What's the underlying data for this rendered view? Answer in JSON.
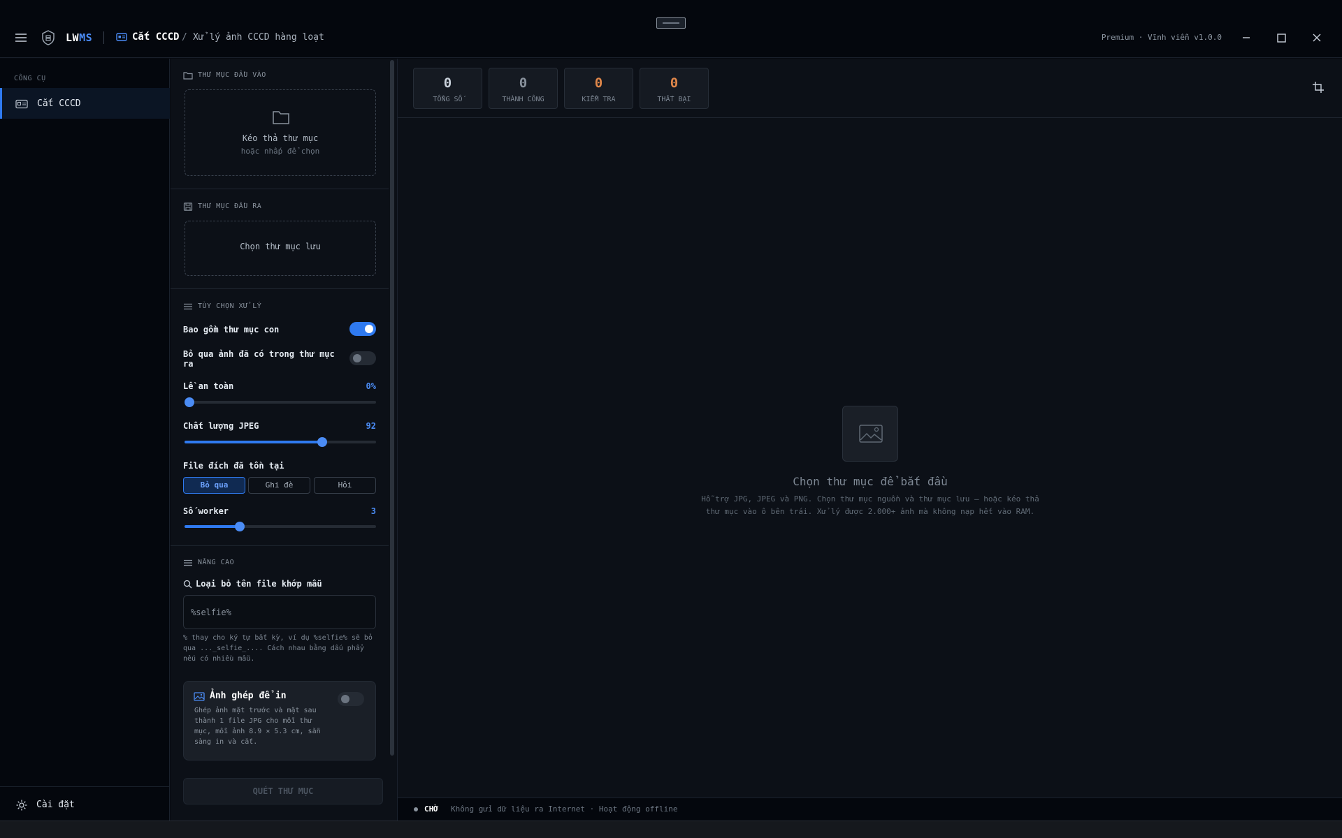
{
  "titlebar": {
    "brand_prefix": "LW",
    "brand_accent": "MS",
    "breadcrumb_main": "Cắt CCCD",
    "breadcrumb_sep": "/",
    "breadcrumb_sub": "Xử lý ảnh CCCD hàng loạt",
    "plan": "Premium · Vĩnh viễn  v1.0.0"
  },
  "nav": {
    "section": "CÔNG CỤ",
    "items": [
      {
        "label": "Cắt CCCD",
        "icon": "id-card-icon",
        "active": true
      }
    ],
    "settings_label": "Cài đặt"
  },
  "panel": {
    "input": {
      "header": "THƯ MỤC ĐẦU VÀO",
      "dropzone_title": "Kéo thả thư mục",
      "dropzone_sub": "hoặc nhấp để chọn"
    },
    "output": {
      "header": "THƯ MỤC ĐẦU RA",
      "dropzone_label": "Chọn thư mục lưu"
    },
    "options": {
      "header": "TÙY CHỌN XỬ LÝ",
      "include_subfolders": {
        "label": "Bao gồm thư mục con",
        "on": true
      },
      "skip_existing": {
        "label": "Bỏ qua ảnh đã có trong thư mục ra",
        "on": false
      },
      "safety_margin": {
        "label": "Lề an toàn",
        "value_text": "0%",
        "fraction": 0.0
      },
      "jpeg_quality": {
        "label": "Chất lượng JPEG",
        "value_text": "92",
        "fraction": 0.72
      },
      "existing_file": {
        "label": "File đích đã tồn tại",
        "choices": [
          "Bỏ qua",
          "Ghi đè",
          "Hỏi"
        ],
        "selected": "Bỏ qua"
      },
      "workers": {
        "label": "Số worker",
        "value_text": "3",
        "fraction": 0.29
      }
    },
    "advanced": {
      "header": "NÂNG CAO",
      "filter_label": "Loại bỏ tên file khớp mẫu",
      "filter_placeholder": "%selfie%",
      "filter_hint": "% thay cho ký tự bất kỳ, ví dụ %selfie% sẽ bỏ qua ..._selfie_.... Cách nhau bằng dấu phẩy nếu có nhiều mẫu.",
      "print_title": "Ảnh ghép để in",
      "print_desc": "Ghép ảnh mặt trước và mặt sau thành 1 file JPG cho mỗi thư mục, mỗi ảnh 8.9 × 5.3 cm, sẵn sàng in và cắt.",
      "print_on": false
    },
    "scan_button": "QUÉT THƯ MỤC"
  },
  "stats": [
    {
      "value": "0",
      "label": "TỔNG SỐ",
      "color": "#c9d1db"
    },
    {
      "value": "0",
      "label": "THÀNH CÔNG",
      "color": "#8a939e"
    },
    {
      "value": "0",
      "label": "KIỂM TRA",
      "color": "#e0874a"
    },
    {
      "value": "0",
      "label": "THẤT BẠI",
      "color": "#e0874a"
    }
  ],
  "empty": {
    "title": "Chọn thư mục để bắt đầu",
    "desc": "Hỗ trợ JPG, JPEG và PNG. Chọn thư mục nguồn và thư mục lưu — hoặc kéo thả thư mục vào ô bên trái. Xử lý được 2.000+ ảnh mà không nạp hết vào RAM."
  },
  "status": {
    "state": "CHỜ",
    "message": "Không gửi dữ liệu ra Internet · Hoạt động offline"
  },
  "colors": {
    "accent": "#2f7af0",
    "warning": "#e0874a"
  }
}
